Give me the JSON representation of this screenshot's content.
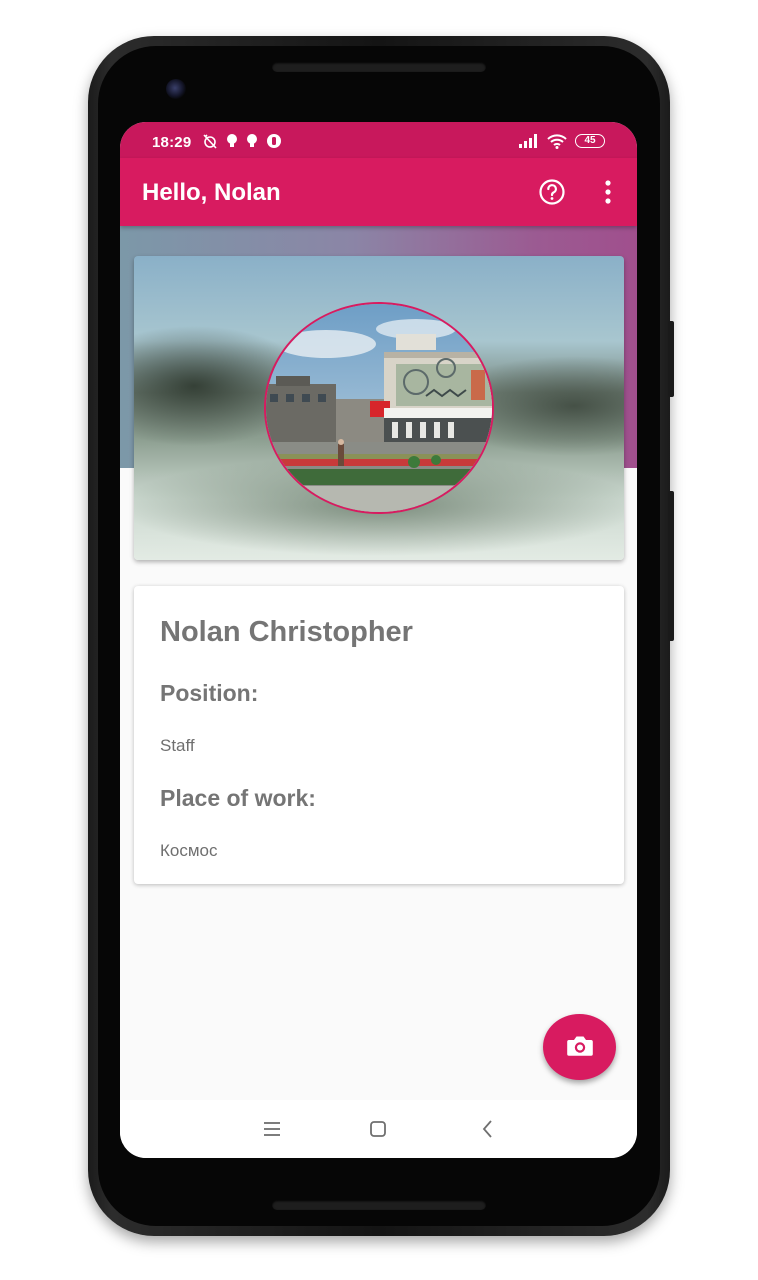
{
  "status_bar": {
    "time": "18:29",
    "battery": "45"
  },
  "app_bar": {
    "title": "Hello, Nolan"
  },
  "profile": {
    "name": "Nolan Christopher",
    "position_label": "Position:",
    "position_value": "Staff",
    "workplace_label": "Place of work:",
    "workplace_value": "Космос"
  },
  "icons": {
    "help": "help-circle-icon",
    "more": "more-vert-icon",
    "fab": "camera-icon",
    "nav_recents": "menu-icon",
    "nav_home": "square-icon",
    "nav_back": "chevron-left-icon"
  },
  "colors": {
    "primary": "#d81b60",
    "primary_dark": "#c8185c",
    "text_gray": "#757575"
  }
}
